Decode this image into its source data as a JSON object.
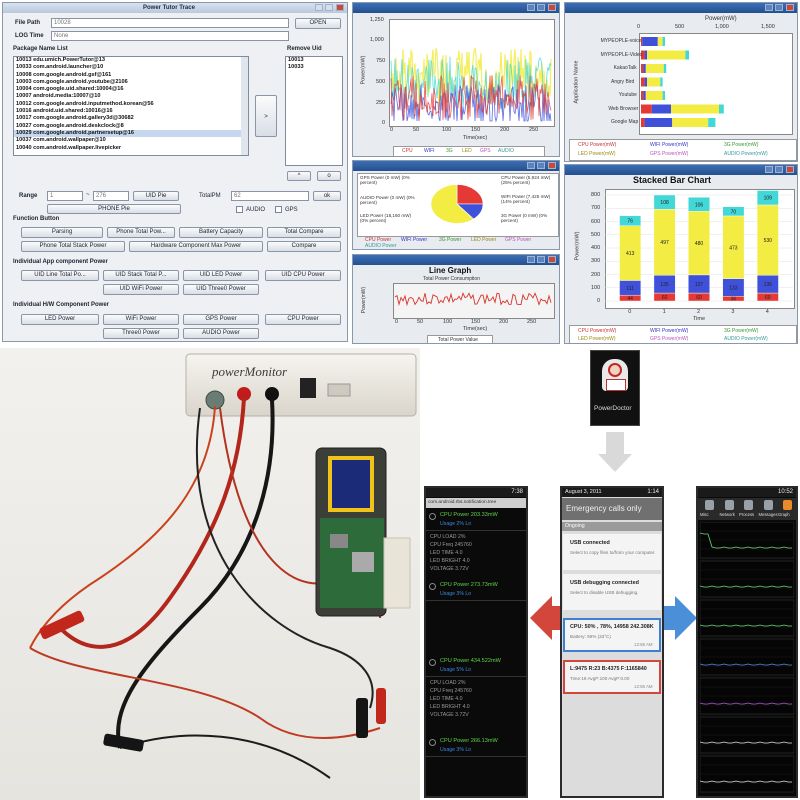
{
  "main_app": {
    "title": "Power Tutor Trace",
    "file_path_label": "File Path",
    "file_path_value": "10028",
    "log_time_label": "LOG Time",
    "log_time_value": "None",
    "open_label": "OPEN",
    "package_list_label": "Package Name List",
    "remove_uid_label": "Remove Uid",
    "packages": [
      "10013 edu.umich.PowerTutor@13",
      "10033 com.android.launcher@10",
      "10008 com.google.android.gsf@161",
      "10003 com.google.android.youtube@2106",
      "10004 com.google.uid.shared:10004@16",
      "10007 android.media:10007@10",
      "10012 com.google.android.inputmethod.korean@56",
      "10016 android.uid.shared:10016@16",
      "10017 com.google.android.gallery3d@30682",
      "10027 com.google.android.deskclock@8",
      "10029 com.google.android.partnersetup@16",
      "10037 com.android.wallpaper@10",
      "10040 com.android.wallpaper.livepicker"
    ],
    "selected_index": 10,
    "removed_uids": [
      "10013",
      "10033"
    ],
    "move_label": ">",
    "up_label": "^",
    "ok_label": "o",
    "range_label": "Range",
    "range_from": "1",
    "range_to": "276",
    "uid_pie_label": "UID Pie",
    "phone_pie_label": "PHONE Pie",
    "total_pm_label": "TotalPM",
    "total_pm_value": "62",
    "ok2_label": "ok",
    "audio_label": "AUDIO",
    "gps_label": "GPS",
    "function_button_label": "Function Button",
    "function_buttons": [
      "Parsing",
      "Phone Total Pow...",
      "Battery Capacity",
      "Total Compare",
      "Phone Total Stack Power",
      "Hardware Component Max Power",
      "Compare"
    ],
    "app_component_label": "Individual App component Power",
    "app_buttons": [
      "UID Line Total Po...",
      "UID Stack Total P...",
      "UID LED Power",
      "UID CPU Power",
      "UID WiFi Power",
      "UID Three0 Power"
    ],
    "hw_component_label": "Individual H/W Component Power",
    "hw_buttons": [
      "LED Power",
      "WiFi Power",
      "GPS Power",
      "CPU Power",
      "Three0 Power",
      "AUDIO Power"
    ]
  },
  "line_chart_window": {
    "ylabel": "Power(mW)",
    "xlabel": "Time(sec)",
    "legend": [
      "CPU",
      "WIFI",
      "3G",
      "LED",
      "GPS",
      "AUDIO"
    ]
  },
  "hbar_window": {
    "title": "Power(mW)",
    "ylabel": "Application Name",
    "legend": [
      "CPU Power(mW)",
      "WIFI Power(mW)",
      "3G Power(mW)",
      "LED Power(mW)",
      "GPS Power(mW)",
      "AUDIO Power(mW)"
    ]
  },
  "pie_window": {
    "labels_left": [
      "GPS Power (0 mW) (0% percent)",
      "AUDIO Power (0 mW) (0% percent)",
      "LED Power (18,160 mW) (0% percent)"
    ],
    "labels_right": [
      "CPU Power (5,924 mW) (25% percent)",
      "WIFI Power (7,425 mW) (14% percent)",
      "3G Power (0 mW) (0% percent)"
    ],
    "legend": [
      "CPU Power",
      "WIFI Power",
      "3G Power",
      "LED Power",
      "GPS Power",
      "AUDIO Power"
    ]
  },
  "line_graph_window": {
    "title": "Line Graph",
    "subtitle": "Total Power Consumption",
    "ylabel": "Power(mW)",
    "xlabel": "Time(sec)",
    "legend": "Total Power Value"
  },
  "stacked_window": {
    "title": "Stacked Bar Chart",
    "ylabel": "Power(mW)",
    "xlabel": "Time",
    "legend": [
      "CPU Power(mW)",
      "WIFI Power(mW)",
      "3G Power(mW)",
      "LED Power(mW)",
      "GPS Power(mW)",
      "AUDIO Power(mW)"
    ]
  },
  "hardware_photo": {
    "device_label": "powerMonitor"
  },
  "powerdoctor": {
    "app_label": "PowerDoctor"
  },
  "phone_left": {
    "time": "7:38",
    "header": "com.android.rbs.notification.tree",
    "items": [
      {
        "title": "CPU Power 203.33mW",
        "sub": "Usage 2% Lo"
      },
      {
        "title": "CPU Power 273.73mW",
        "sub": "Usage 3% Lo"
      },
      {
        "title": "CPU Power 434.522mW",
        "sub": "Usage 5% Lo"
      },
      {
        "title": "CPU Power 266.13mW",
        "sub": "Usage 3% Lo"
      }
    ],
    "detail": [
      "CPU LOAD 2%",
      "CPU Freq 245760",
      "LED TIME 4.0",
      "LED BRIGHT 4.0",
      "VOLTAGE 3.72V"
    ]
  },
  "phone_center": {
    "time": "1:14",
    "date": "August 3, 2011",
    "emergency": "Emergency calls only",
    "ongoing": "Ongoing",
    "items": [
      {
        "title": "USB connected",
        "sub": "Select to copy files to/from your computer."
      },
      {
        "title": "USB debugging connected",
        "sub": "Select to disable USB debugging."
      },
      {
        "title": "CPU: 50% , 78%, 14958 242.308K",
        "sub": "Battery: 59% (33°C)"
      },
      {
        "title": "L:9475 R:23 B:4375 F:1165840",
        "sub": "Time:19 AvgP:100 AvgP:0.00"
      }
    ],
    "times": [
      "12:58 AM",
      "12:58 AM"
    ]
  },
  "phone_right": {
    "time": "10:52",
    "tabs": [
      "Misc",
      "Network",
      "Process",
      "Messages",
      "Graph"
    ]
  },
  "colors": {
    "cpu": "#e53935",
    "wifi": "#3f51d9",
    "g3": "#47c83e",
    "led": "#f2ec43",
    "gps": "#e58be0",
    "audio": "#42d8d8",
    "arrow_left": "#d2463c",
    "arrow_right": "#4a8fd8"
  },
  "chart_data": [
    {
      "type": "bar",
      "title": "Stacked Bar Chart",
      "xlabel": "Time",
      "ylabel": "Power(mW)",
      "categories": [
        "0",
        "1",
        "2",
        "3",
        "4"
      ],
      "stacked": true,
      "ylim": [
        0,
        800
      ],
      "series": [
        {
          "name": "CPU Power(mW)",
          "values": [
            44,
            60,
            60,
            36,
            60
          ]
        },
        {
          "name": "WIFI Power(mW)",
          "values": [
            111,
            135,
            137,
            133,
            135
          ]
        },
        {
          "name": "3G Power(mW)",
          "values": [
            0,
            0,
            0,
            0,
            0
          ]
        },
        {
          "name": "LED Power(mW)",
          "values": [
            413,
            497,
            480,
            473,
            530
          ]
        },
        {
          "name": "GPS Power(mW)",
          "values": [
            0,
            0,
            0,
            0,
            0
          ]
        },
        {
          "name": "AUDIO Power(mW)",
          "values": [
            76,
            108,
            106,
            70,
            109
          ]
        }
      ]
    },
    {
      "type": "pie",
      "categories": [
        "CPU Power",
        "WIFI Power",
        "LED Power"
      ],
      "values": [
        25,
        14,
        61
      ]
    }
  ]
}
